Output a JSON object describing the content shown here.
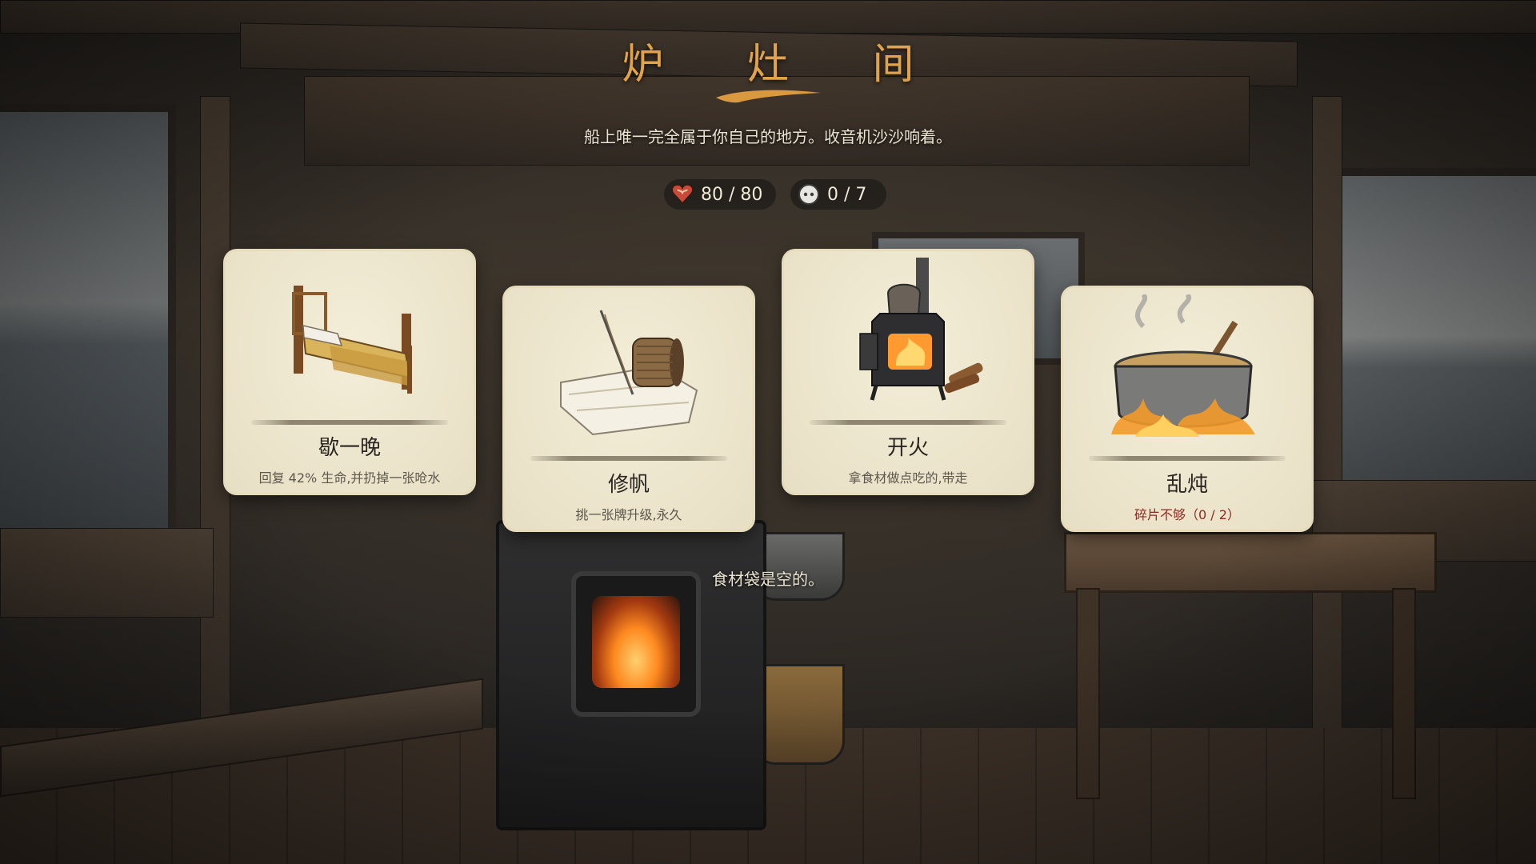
{
  "header": {
    "title": "炉 灶 间",
    "subtitle": "船上唯一完全属于你自己的地方。收音机沙沙响着。"
  },
  "stats": {
    "hp": "80 / 80",
    "fragments": "0 / 7"
  },
  "cards": [
    {
      "name": "歇一晚",
      "desc": "回复 42% 生命,并扔掉一张呛水",
      "icon": "bed-icon"
    },
    {
      "name": "修帆",
      "desc": "挑一张牌升级,永久",
      "icon": "sewing-icon"
    },
    {
      "name": "开火",
      "desc": "拿食材做点吃的,带走",
      "icon": "wood-stove-icon"
    },
    {
      "name": "乱炖",
      "desc": "碎片不够（0 / 2）",
      "icon": "stew-pot-icon"
    }
  ],
  "ingredient_bag": "食材袋是空的。",
  "colors": {
    "title": "#e0a34b",
    "card": "#f0e8cc",
    "warning": "#8e2a22"
  }
}
